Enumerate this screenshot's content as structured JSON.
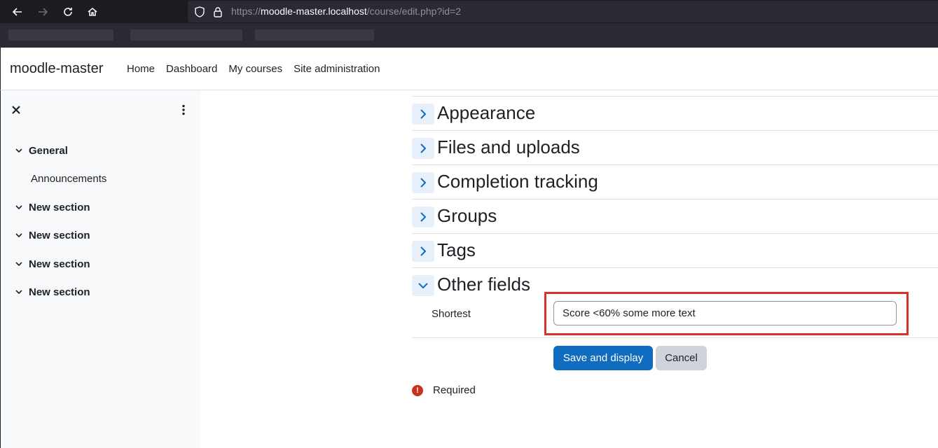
{
  "browser": {
    "url_scheme": "https://",
    "url_host": "moodle-master.localhost",
    "url_path": "/course/edit.php?id=2"
  },
  "navbar": {
    "brand": "moodle-master",
    "links": [
      "Home",
      "Dashboard",
      "My courses",
      "Site administration"
    ]
  },
  "sidebar": {
    "items": [
      {
        "label": "General",
        "expanded": true
      },
      {
        "label": "Announcements"
      },
      {
        "label": "New section"
      },
      {
        "label": "New section"
      },
      {
        "label": "New section"
      },
      {
        "label": "New section"
      }
    ]
  },
  "main": {
    "sections": [
      {
        "title": "Appearance",
        "expanded": false
      },
      {
        "title": "Files and uploads",
        "expanded": false
      },
      {
        "title": "Completion tracking",
        "expanded": false
      },
      {
        "title": "Groups",
        "expanded": false
      },
      {
        "title": "Tags",
        "expanded": false
      },
      {
        "title": "Other fields",
        "expanded": true
      }
    ],
    "field": {
      "label": "Shortest",
      "value": "Score <60% some more text"
    },
    "buttons": {
      "save": "Save and display",
      "cancel": "Cancel"
    },
    "required_label": "Required"
  },
  "colors": {
    "primary": "#0f6cbf",
    "highlight": "#d9302c",
    "danger": "#ca3120"
  }
}
